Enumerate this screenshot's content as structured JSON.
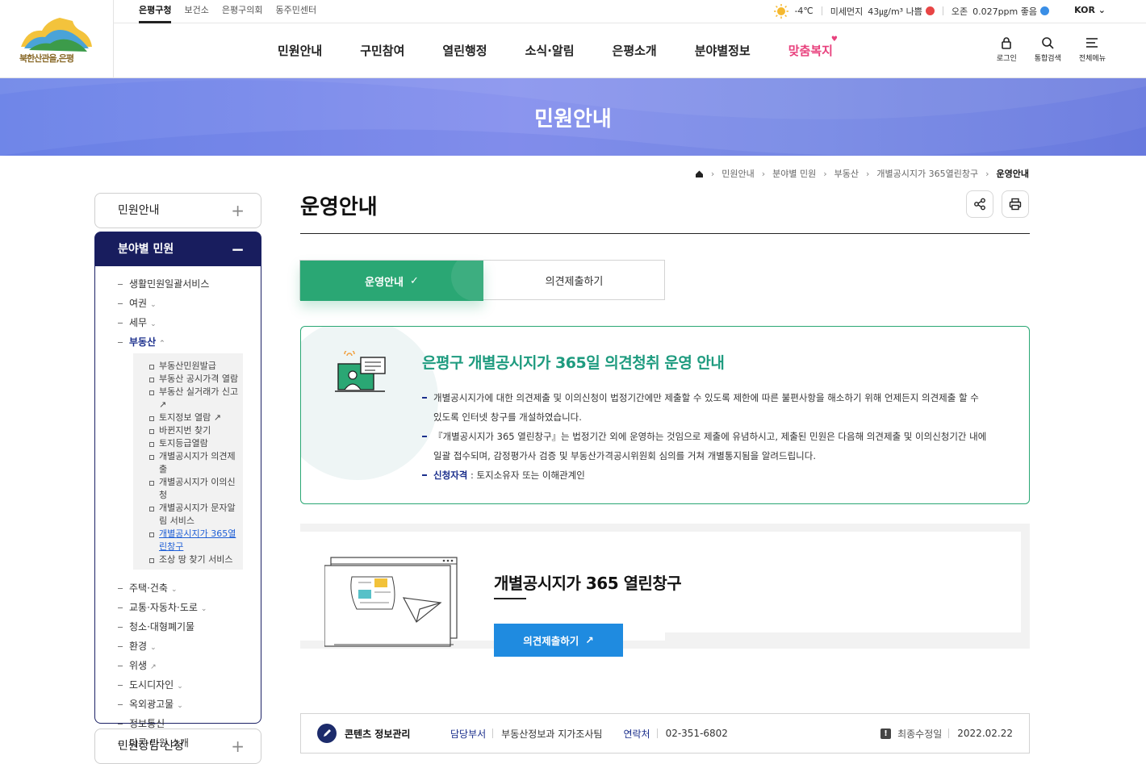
{
  "logo": {
    "name": "북한산관을,은평"
  },
  "topbar": {
    "sitelinks": [
      "은평구청",
      "보건소",
      "은평구의회",
      "동주민센터"
    ],
    "temp": "-4℃",
    "dust_label": "미세먼지",
    "dust_value": "43㎍/m³ 나쁨",
    "ozone_label": "오존",
    "ozone_value": "0.027ppm 좋음",
    "lang": "KOR"
  },
  "gnb": [
    "민원안내",
    "구민참여",
    "열린행정",
    "소식·알림",
    "은평소개",
    "분야별정보",
    "맞춤복지"
  ],
  "utils": {
    "login": "로그인",
    "search": "통합검색",
    "menu": "전체메뉴"
  },
  "colors": {
    "accent_green": "#2aa774",
    "navy": "#181d5e",
    "banner": "#7e8fe6",
    "button_blue": "#1f8be0",
    "special_menu": "#e8417d"
  },
  "banner": {
    "title": "민원안내"
  },
  "breadcrumb": [
    "민원안내",
    "분야별 민원",
    "부동산",
    "개별공시지가 365열린창구",
    "운영안내"
  ],
  "sidebar": {
    "top": "민원안내",
    "group": "분야별 민원",
    "items": [
      {
        "label": "생활민원일괄서비스"
      },
      {
        "label": "여권"
      },
      {
        "label": "세무"
      },
      {
        "label": "부동산"
      },
      {
        "label": "주택·건축"
      },
      {
        "label": "교통·자동차·도로"
      },
      {
        "label": "청소·대형폐기물"
      },
      {
        "label": "환경"
      },
      {
        "label": "위생"
      },
      {
        "label": "도시디자인"
      },
      {
        "label": "옥외광고물"
      },
      {
        "label": "정보통신"
      },
      {
        "label": "다른 민원 소개"
      }
    ],
    "realestate": [
      "부동산민원발급",
      "부동산 공시가격 열람",
      "부동산 실거래가 신고",
      "토지정보 열람",
      "바뀐지번 찾기",
      "토지등급열람",
      "개별공시지가 의견제출",
      "개별공시지가 이의신청",
      "개별공시지가 문자알림 서비스",
      "개별공시지가 365열린창구",
      "조상 땅 찾기 서비스"
    ],
    "bottom": "민원상담·신청"
  },
  "page": {
    "title": "운영안내"
  },
  "tabs": {
    "active": "운영안내",
    "other": "의견제출하기"
  },
  "info": {
    "heading": "은평구 개별공시지가 365일 의견청취 운영 안내",
    "p1": "개별공시지가에 대한 의견제출 및 이의신청이 법정기간에만 제출할 수 있도록 제한에 따른 불편사항을 해소하기 위해 언제든지 의견제출 할 수 있도록 인터넷 창구를 개설하였습니다.",
    "p2": "『개별공시지가 365 열린창구』는 법정기간 외에 운영하는 것임으로 제출에 유념하시고, 제출된 민원은 다음해 의견제출 및 이의신청기간 내에 일괄 접수되며, 감정평가사 검증 및 부동산가격공시위원회 심의를 거쳐 개별통지됨을 알려드립니다.",
    "p3_key": "신청자격",
    "p3_val": " : 토지소유자 또는 이해관계인"
  },
  "gobox": {
    "title": "개별공시지가 365 열린창구",
    "button": "의견제출하기"
  },
  "meta": {
    "label": "콘텐츠 정보관리",
    "dept_key": "담당부서",
    "dept": "부동산정보과 지가조사팀",
    "tel_key": "연락처",
    "tel": "02-351-6802",
    "updated_key": "최종수정일",
    "updated": "2022.02.22"
  }
}
